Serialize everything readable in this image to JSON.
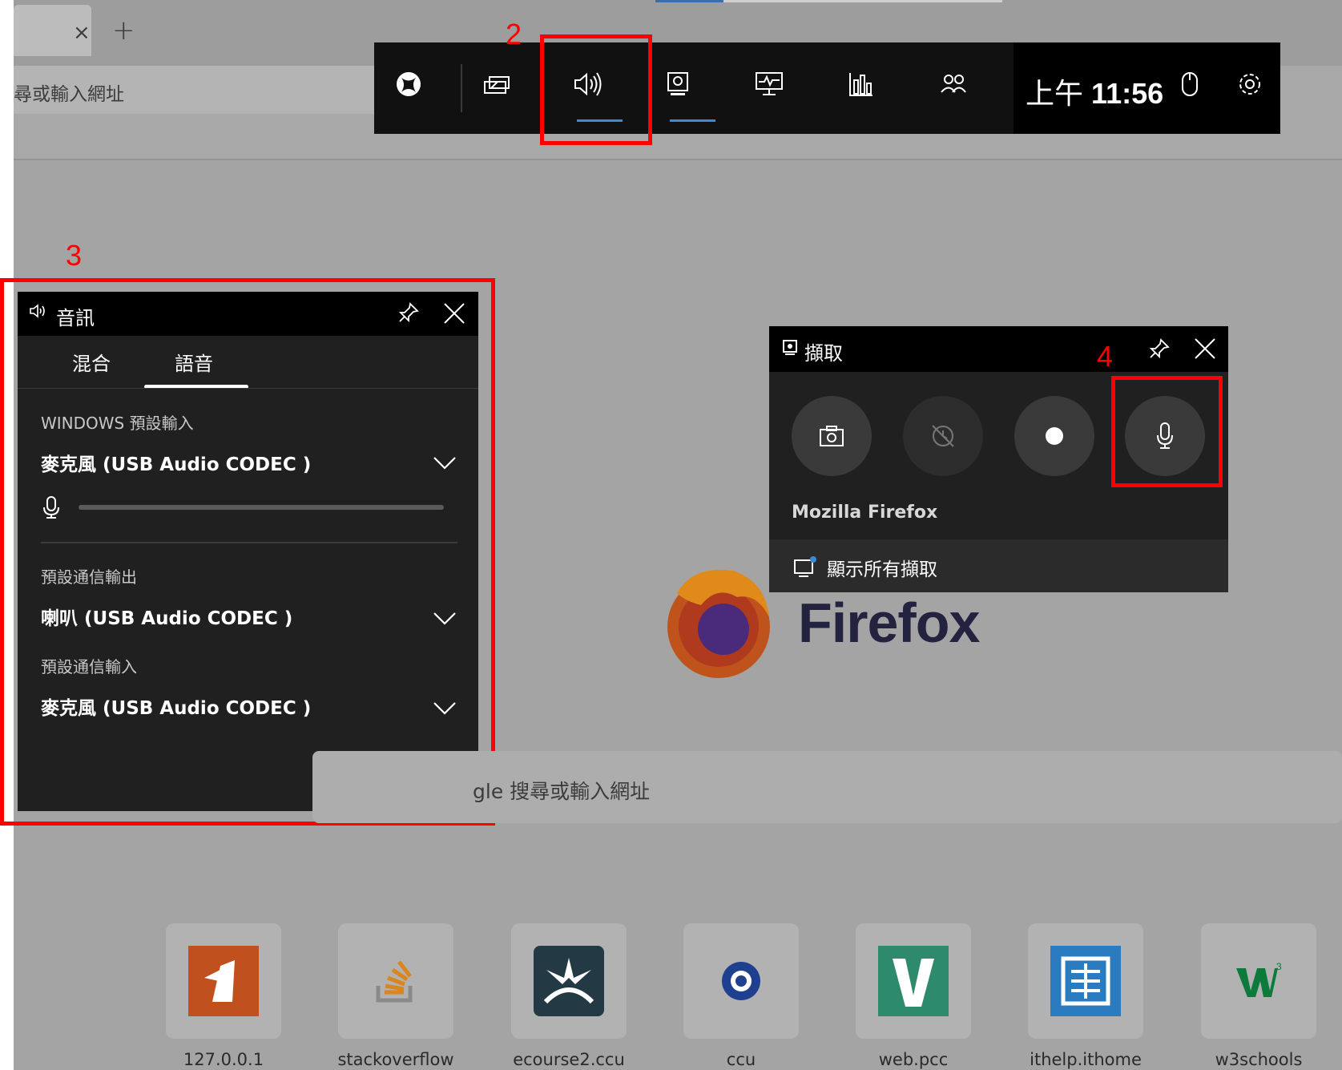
{
  "browser": {
    "tab_close_glyph": "×",
    "tab_new_glyph": "+",
    "url_placeholder": "尋或輸入網址"
  },
  "gamebar": {
    "time_prefix": "上午",
    "time": "11:56",
    "accent_color": "#3a8ad8"
  },
  "annotations": {
    "num_2": "2",
    "num_3": "3",
    "num_4": "4",
    "color": "#ff0000"
  },
  "audio_panel": {
    "title": "音訊",
    "tabs": [
      {
        "label": "混合"
      },
      {
        "label": "語音"
      }
    ],
    "active_tab": "語音",
    "windows_input_label": "WINDOWS 預設輸入",
    "windows_input_device": "麥克風 (USB Audio CODEC )",
    "mic_level": 0,
    "comm_output_label": "預設通信輸出",
    "comm_output_device": "喇叭 (USB Audio CODEC )",
    "comm_input_label": "預設通信輸入",
    "comm_input_device": "麥克風 (USB Audio CODEC )"
  },
  "capture_panel": {
    "title": "擷取",
    "app_name": "Mozilla Firefox",
    "show_all_label": "顯示所有擷取"
  },
  "newtab": {
    "brand": "Firefox",
    "search_placeholder": "gle 搜尋或輸入網址",
    "top_sites": [
      {
        "label": "127.0.0.1"
      },
      {
        "label": "stackoverflow"
      },
      {
        "label": "ecourse2.ccu"
      },
      {
        "label": "ccu"
      },
      {
        "label": "web.pcc"
      },
      {
        "label": "ithelp.ithome"
      },
      {
        "label": "w3schools"
      }
    ]
  }
}
